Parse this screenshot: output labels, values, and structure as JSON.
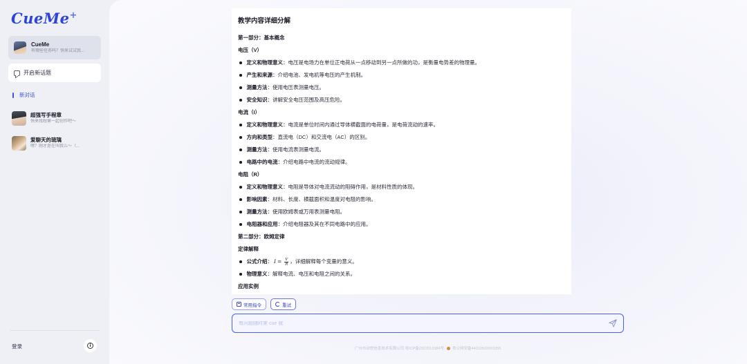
{
  "sidebar": {
    "logo": "CueMe",
    "logo_mark": "+",
    "assistant": {
      "name": "CueMe",
      "subtitle": "有哪些任务吗？快来试试我..."
    },
    "new_topic_label": "开启新话题",
    "active_conversation": "新对话",
    "conversations": [
      {
        "title": "超强写手程章",
        "subtitle": "快来找程章一起创作吧～"
      },
      {
        "title": "爱聊天的琉璃",
        "subtitle": "嘿？刚才是在叫我么～（..."
      }
    ],
    "login_label": "登录",
    "info_icon": "info-icon"
  },
  "document": {
    "title": "教学内容详细分解",
    "lines": [
      {
        "type": "heading",
        "text": "第一部分：基本概念"
      },
      {
        "type": "heading",
        "text": "电压（V）"
      },
      {
        "type": "bullet",
        "key": "定义和物理意义",
        "text": "：电压是电场力在单位正电荷从一点移动到另一点所做的功，是衡量电势差的物理量。"
      },
      {
        "type": "bullet",
        "key": "产生和来源",
        "text": "：介绍电池、发电机等电压的产生机制。"
      },
      {
        "type": "bullet",
        "key": "测量方法",
        "text": "：使用电压表测量电压。"
      },
      {
        "type": "bullet",
        "key": "安全知识",
        "text": "：讲解安全电压范围及高压危险。"
      },
      {
        "type": "heading",
        "text": "电流（I）"
      },
      {
        "type": "bullet",
        "key": "定义和物理意义",
        "text": "：电流是单位时间内通过导体横截面的电荷量，是电荷流动的速率。"
      },
      {
        "type": "bullet",
        "key": "方向和类型",
        "text": "：直流电（DC）和交流电（AC）的区别。"
      },
      {
        "type": "bullet",
        "key": "测量方法",
        "text": "：使用电流表测量电流。"
      },
      {
        "type": "bullet",
        "key": "电路中的电流",
        "text": "：介绍电路中电流的流动规律。"
      },
      {
        "type": "heading",
        "text": "电阻（R）"
      },
      {
        "type": "bullet",
        "key": "定义和物理意义",
        "text": "：电阻是导体对电流流动的阻碍作用，是材料性质的体现。"
      },
      {
        "type": "bullet",
        "key": "影响因素",
        "text": "：材料、长度、横截面积和温度对电阻的影响。"
      },
      {
        "type": "bullet",
        "key": "测量方法",
        "text": "：使用欧姆表或万用表测量电阻。"
      },
      {
        "type": "bullet",
        "key": "电阻器和应用",
        "text": "：介绍电阻器及其在不同电路中的应用。"
      },
      {
        "type": "heading",
        "text": "第二部分：欧姆定律"
      },
      {
        "type": "heading",
        "text": "定律解释"
      },
      {
        "type": "formula",
        "key": "公式介绍",
        "pre": "：",
        "formula_lhs": "I",
        "formula_eq": "=",
        "formula_num": "V",
        "formula_den": "R",
        "text": "，详细解释每个变量的意义。"
      },
      {
        "type": "bullet",
        "key": "物理意义",
        "text": "：解释电流、电压和电阻之间的关系。"
      },
      {
        "type": "heading",
        "text": "应用实例"
      }
    ]
  },
  "actions": {
    "commands_label": "常用指令",
    "retry_label": "重试"
  },
  "input": {
    "placeholder": "有问题随时来 cue 我",
    "value": ""
  },
  "footer": {
    "company": "广州市动悦信息技术有限公司 粤ICP备2022013384号",
    "police": "粤公网安备44010502003355"
  },
  "colors": {
    "accent": "#3e52e0",
    "sidebar_bg": "#eef0f6",
    "card_bg": "#ffffff"
  }
}
